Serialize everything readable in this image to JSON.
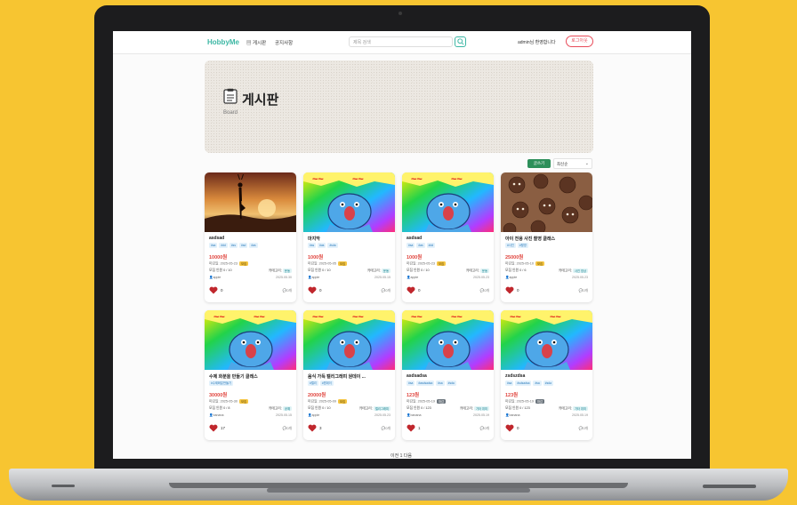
{
  "nav": {
    "logo": "HobbyMe",
    "links": [
      "게시판",
      "공지사항"
    ],
    "search_placeholder": "제목 검색",
    "greeting": "admin님 환영합니다",
    "logout": "로그아웃"
  },
  "banner": {
    "title": "게시판",
    "subtitle": "Board"
  },
  "controls": {
    "write": "글쓰기",
    "sort": "최신순"
  },
  "cards": [
    {
      "title": "asdsad",
      "tags": [
        "#sa",
        "#dd",
        "#ss",
        "#sd",
        "#as"
      ],
      "price": "10000원",
      "deadline": "마감일: 2025-05-23",
      "status": "모집",
      "status_type": "open",
      "members": "모집 인원 0 / 10",
      "category_label": "카테고리:",
      "category": "운동",
      "author": "apple",
      "date": "2025.05.30",
      "likes": "0",
      "comments": "0개",
      "image": "yoga"
    },
    {
      "title": "마지막",
      "tags": [
        "#ss",
        "#as",
        "#sda"
      ],
      "price": "1000원",
      "deadline": "마감일: 2025-05-05",
      "status": "모집",
      "status_type": "open",
      "members": "모집 인원 0 / 10",
      "category_label": "카테고리:",
      "category": "운동",
      "author": "apple",
      "date": "2025.05.15",
      "likes": "0",
      "comments": "0개",
      "image": "meme"
    },
    {
      "title": "asdsad",
      "tags": [
        "#sa",
        "#as",
        "#dd"
      ],
      "price": "1000원",
      "deadline": "마감일: 2025-05-23",
      "status": "모집",
      "status_type": "open",
      "members": "모집 인원 0 / 10",
      "category_label": "카테고리:",
      "category": "운동",
      "author": "apple",
      "date": "2025.05.23",
      "likes": "0",
      "comments": "0개",
      "image": "meme"
    },
    {
      "title": "아이 전용 사진 촬영 클래스",
      "tags": [
        "#사진",
        "#촬영"
      ],
      "price": "25000원",
      "deadline": "마감일: 2025-05-10",
      "status": "모집",
      "status_type": "open",
      "members": "모집 인원 0 / 6",
      "category_label": "카테고리:",
      "category": "사진 영상",
      "author": "apple",
      "date": "2025.05.23",
      "likes": "0",
      "comments": "0개",
      "image": "cookies"
    },
    {
      "title": "수제 화분을 만들기 클래스",
      "tags": [
        "#수제화분만들기"
      ],
      "price": "30000원",
      "deadline": "마감일: 2025-05-30",
      "status": "모집",
      "status_type": "open",
      "members": "모집 인원 0 / 8",
      "category_label": "카테고리:",
      "category": "공예",
      "author": "banana",
      "date": "2025.05.15",
      "likes": "17",
      "comments": "0개",
      "image": "meme"
    },
    {
      "title": "음식 가득 캘리그래피 원데이 ...",
      "tags": [
        "#캘리",
        "#원데이"
      ],
      "price": "20000원",
      "deadline": "마감일: 2025-05-09",
      "status": "모집",
      "status_type": "open",
      "members": "모집 인원 0 / 10",
      "category_label": "카테고리:",
      "category": "캘리그래피",
      "author": "apple",
      "date": "2025.05.23",
      "likes": "3",
      "comments": "0개",
      "image": "meme"
    },
    {
      "title": "asdsadsa",
      "tags": [
        "#sa",
        "#asdsadsa",
        "#sa",
        "#sda"
      ],
      "price": "123원",
      "deadline": "마감일: 2025-05-19",
      "status": "마감",
      "status_type": "closed",
      "members": "모집 인원 0 / 123",
      "category_label": "카테고리:",
      "category": "기타 취미",
      "author": "banana",
      "date": "2025.05.19",
      "likes": "1",
      "comments": "0개",
      "image": "meme"
    },
    {
      "title": "zsdszdsa",
      "tags": [
        "#sa",
        "#sdsadsa",
        "#sa",
        "#sda"
      ],
      "price": "123원",
      "deadline": "마감일: 2025-05-19",
      "status": "마감",
      "status_type": "closed",
      "members": "모집 인원 0 / 123",
      "category_label": "카테고리:",
      "category": "기타 취미",
      "author": "banana",
      "date": "2025.05.19",
      "likes": "0",
      "comments": "0개",
      "image": "meme"
    }
  ],
  "pager": "이전 1 다음",
  "colors": {
    "accent": "#3cb7a4",
    "price": "#e0443d",
    "write_button": "#2d8f5a",
    "logout": "#e84c5a"
  }
}
